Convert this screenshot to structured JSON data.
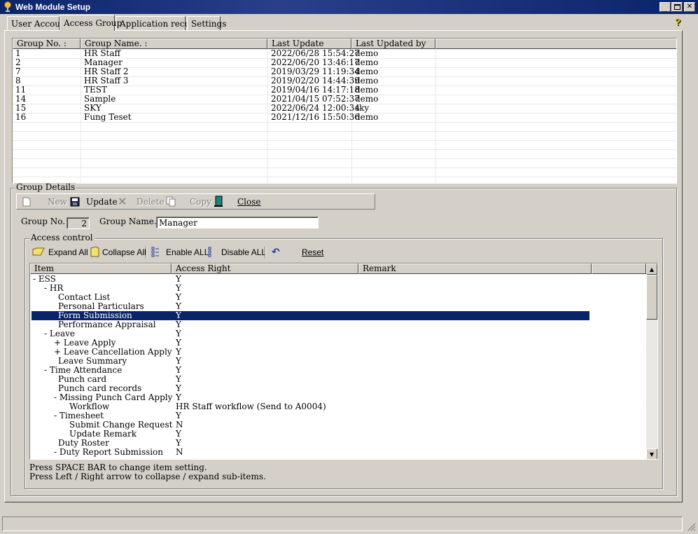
{
  "window": {
    "title": "Web Module Setup"
  },
  "tabs": [
    {
      "label": "User Account"
    },
    {
      "label": "Access Group"
    },
    {
      "label": "Application records"
    },
    {
      "label": "Settings"
    }
  ],
  "groups_table": {
    "columns": [
      "Group No. :",
      "Group Name. :",
      "Last Update",
      "Last Updated by"
    ],
    "rows": [
      {
        "no": "1",
        "name": "HR Staff",
        "update": "2022/06/28 15:54:27",
        "by": "demo"
      },
      {
        "no": "2",
        "name": "Manager",
        "update": "2022/06/20 13:46:17",
        "by": "demo"
      },
      {
        "no": "7",
        "name": "HR Staff 2",
        "update": "2019/03/29 11:19:34",
        "by": "demo"
      },
      {
        "no": "8",
        "name": "HR Staff 3",
        "update": "2019/02/20 14:44:39",
        "by": "demo"
      },
      {
        "no": "11",
        "name": "TEST",
        "update": "2019/04/16 14:17:18",
        "by": "demo"
      },
      {
        "no": "14",
        "name": "Sample",
        "update": "2021/04/15 07:52:37",
        "by": "demo"
      },
      {
        "no": "15",
        "name": "SKY",
        "update": "2022/06/24 12:00:34",
        "by": "sky"
      },
      {
        "no": "16",
        "name": "Fung Teset",
        "update": "2021/12/16 15:50:36",
        "by": "demo"
      }
    ]
  },
  "group_details": {
    "label": "Group Details",
    "toolbar": {
      "new": "New",
      "update": "Update",
      "delete": "Delete",
      "copy": "Copy",
      "close": "Close"
    },
    "group_no_label": "Group No. :",
    "group_no_value": "2",
    "group_name_label": "Group Name. :",
    "group_name_value": "Manager"
  },
  "access_control": {
    "label": "Access control",
    "toolbar": {
      "expand_all": "Expand All",
      "collapse_all": "Collapse All",
      "enable_all": "Enable ALL",
      "disable_all": "Disable ALL",
      "reset": "Reset"
    },
    "columns": [
      "Item",
      "Access Right",
      "Remark"
    ],
    "rows": [
      {
        "item": "- ESS",
        "right": "Y"
      },
      {
        "item": "- HR",
        "right": "Y"
      },
      {
        "item": "Contact List",
        "right": "Y"
      },
      {
        "item": "Personal Particulars",
        "right": "Y"
      },
      {
        "item": "Form Submission",
        "right": "Y"
      },
      {
        "item": "Performance Appraisal",
        "right": "Y"
      },
      {
        "item": "- Leave",
        "right": "Y"
      },
      {
        "item": "+ Leave Apply",
        "right": "Y"
      },
      {
        "item": "+ Leave Cancellation Apply",
        "right": "Y"
      },
      {
        "item": "Leave Summary",
        "right": "Y"
      },
      {
        "item": "- Time Attendance",
        "right": "Y"
      },
      {
        "item": "Punch card",
        "right": "Y"
      },
      {
        "item": "Punch card records",
        "right": "Y"
      },
      {
        "item": "- Missing Punch Card Apply",
        "right": "Y"
      },
      {
        "item": "Workflow",
        "right": "HR Staff workflow (Send to A0004)"
      },
      {
        "item": "- Timesheet",
        "right": "Y"
      },
      {
        "item": "Submit Change Request",
        "right": "N"
      },
      {
        "item": "Update Remark",
        "right": "Y"
      },
      {
        "item": "Duty Roster",
        "right": "Y"
      },
      {
        "item": "- Duty Report Submission",
        "right": "N"
      }
    ],
    "hints": [
      "Press SPACE BAR to change item setting.",
      "Press Left / Right arrow to collapse / expand sub-items."
    ]
  }
}
